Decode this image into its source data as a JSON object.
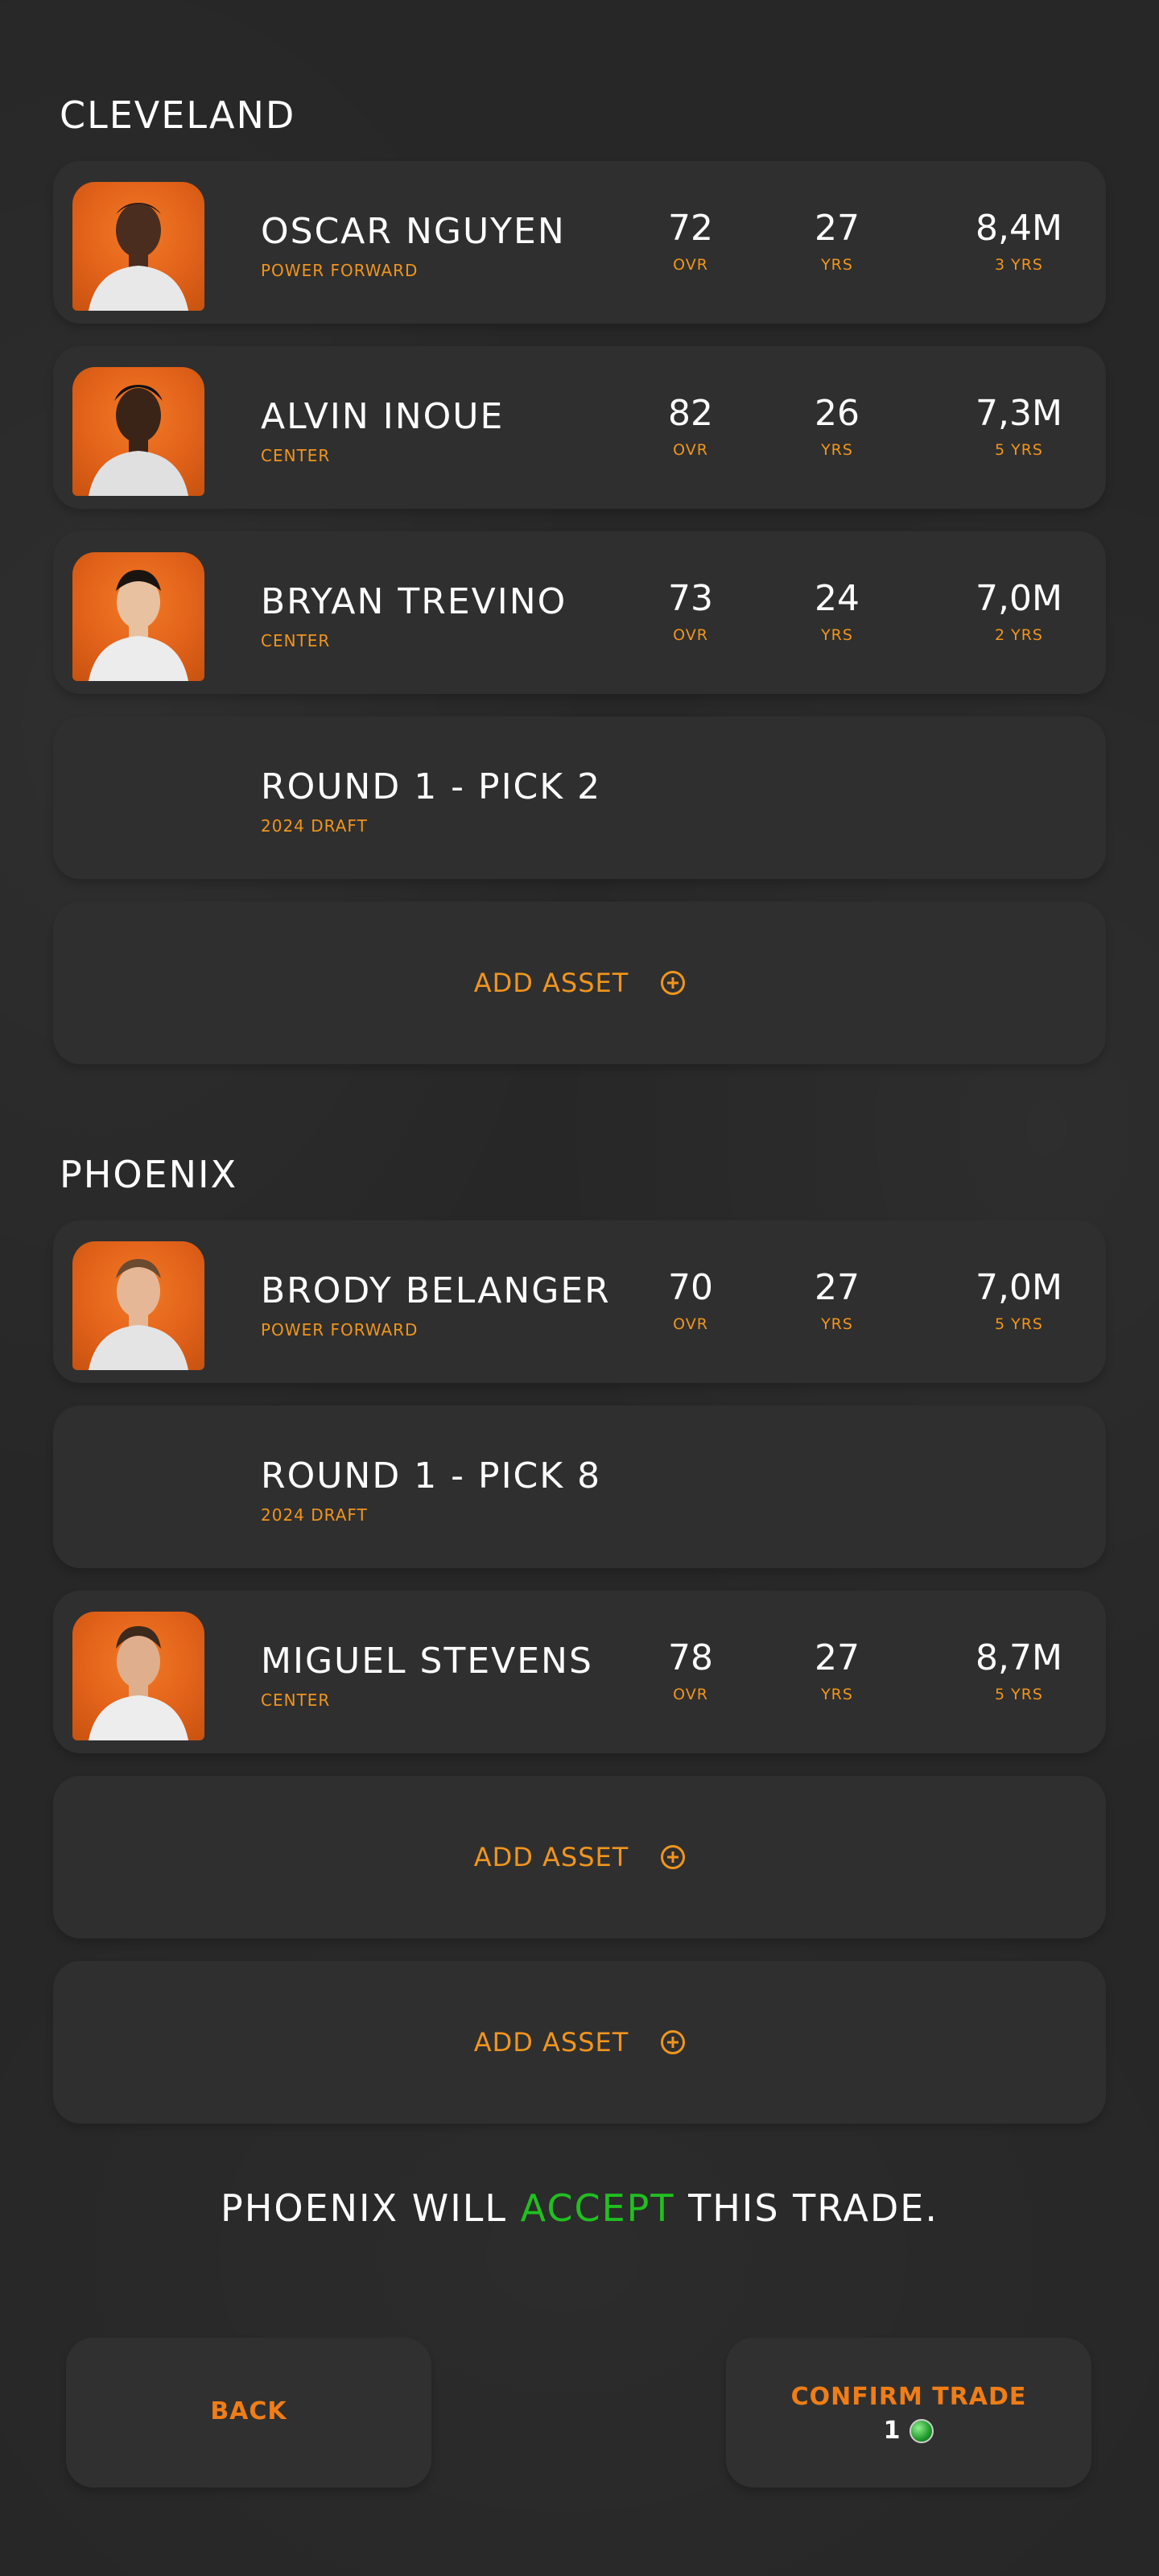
{
  "teams": [
    {
      "name": "CLEVELAND",
      "assets": [
        {
          "kind": "player",
          "name": "OSCAR NGUYEN",
          "position": "POWER FORWARD",
          "ovr": "72",
          "ovr_label": "OVR",
          "age": "27",
          "age_label": "YRS",
          "salary": "8,4M",
          "contract": "3 YRS"
        },
        {
          "kind": "player",
          "name": "ALVIN INOUE",
          "position": "CENTER",
          "ovr": "82",
          "ovr_label": "OVR",
          "age": "26",
          "age_label": "YRS",
          "salary": "7,3M",
          "contract": "5 YRS"
        },
        {
          "kind": "player",
          "name": "BRYAN TREVINO",
          "position": "CENTER",
          "ovr": "73",
          "ovr_label": "OVR",
          "age": "24",
          "age_label": "YRS",
          "salary": "7,0M",
          "contract": "2 YRS"
        },
        {
          "kind": "pick",
          "name": "ROUND 1 - PICK 2",
          "detail": "2024 DRAFT"
        },
        {
          "kind": "add",
          "label": "ADD ASSET"
        }
      ]
    },
    {
      "name": "PHOENIX",
      "assets": [
        {
          "kind": "player",
          "name": "BRODY BELANGER",
          "position": "POWER FORWARD",
          "ovr": "70",
          "ovr_label": "OVR",
          "age": "27",
          "age_label": "YRS",
          "salary": "7,0M",
          "contract": "5 YRS"
        },
        {
          "kind": "pick",
          "name": "ROUND 1 - PICK 8",
          "detail": "2024 DRAFT"
        },
        {
          "kind": "player",
          "name": "MIGUEL STEVENS",
          "position": "CENTER",
          "ovr": "78",
          "ovr_label": "OVR",
          "age": "27",
          "age_label": "YRS",
          "salary": "8,7M",
          "contract": "5 YRS"
        },
        {
          "kind": "add",
          "label": "ADD ASSET"
        },
        {
          "kind": "add",
          "label": "ADD ASSET"
        }
      ]
    }
  ],
  "verdict": {
    "prefix": "PHOENIX WILL ",
    "keyword": "ACCEPT",
    "suffix": " THIS TRADE.",
    "keyword_color": "#20c020"
  },
  "buttons": {
    "back": "BACK",
    "confirm": "CONFIRM TRADE",
    "confirm_cost": "1",
    "cost_icon": "globe-coin-icon"
  },
  "colors": {
    "accent": "#f0951e",
    "background": "#272727",
    "card": "#2f2f2f"
  }
}
